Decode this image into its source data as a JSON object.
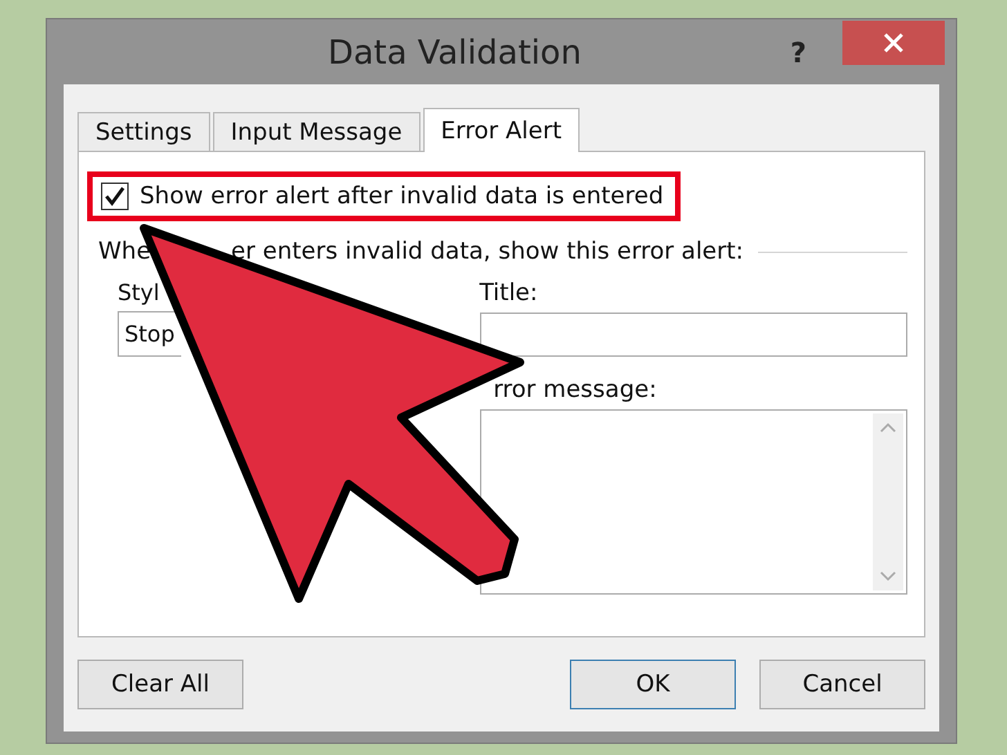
{
  "window": {
    "title": "Data Validation",
    "help": "?"
  },
  "tabs": [
    {
      "label": "Settings",
      "selected": false
    },
    {
      "label": "Input Message",
      "selected": false
    },
    {
      "label": "Error Alert",
      "selected": true
    }
  ],
  "show_alert": {
    "label": "Show error alert after invalid data is entered",
    "checked": true
  },
  "group_label": {
    "visible_start": "Whe",
    "visible_end": "er enters invalid data, show this error alert:"
  },
  "style": {
    "label": "Styl",
    "value": "Stop"
  },
  "title_field": {
    "label": "Title:"
  },
  "message_field": {
    "label": "rror message:"
  },
  "buttons": {
    "clear": "Clear All",
    "ok": "OK",
    "cancel": "Cancel"
  }
}
